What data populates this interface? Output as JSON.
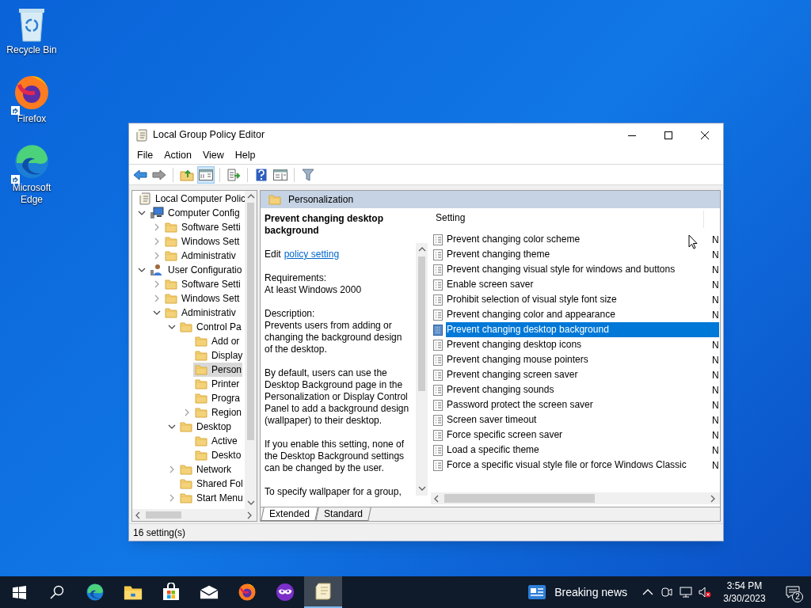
{
  "desktop_icons": [
    {
      "label": "Recycle Bin",
      "kind": "recycle"
    },
    {
      "label": "Firefox",
      "kind": "firefox"
    },
    {
      "label": "Microsoft Edge",
      "kind": "edge"
    }
  ],
  "window": {
    "title": "Local Group Policy Editor"
  },
  "menu": [
    "File",
    "Action",
    "View",
    "Help"
  ],
  "toolbar": [
    {
      "kind": "back",
      "pressed": false
    },
    {
      "kind": "forward",
      "pressed": false
    },
    {
      "kind": "sep"
    },
    {
      "kind": "up",
      "pressed": false
    },
    {
      "kind": "tree",
      "pressed": true
    },
    {
      "kind": "sep"
    },
    {
      "kind": "export",
      "pressed": false
    },
    {
      "kind": "sep"
    },
    {
      "kind": "help",
      "pressed": false
    },
    {
      "kind": "pane",
      "pressed": false
    },
    {
      "kind": "sep"
    },
    {
      "kind": "filter",
      "pressed": false
    }
  ],
  "tree": [
    {
      "label": "Local Computer Polic",
      "kind": "root",
      "selected": false,
      "children": [
        {
          "label": "Computer Config",
          "kind": "computer",
          "expanded": true,
          "selected": false,
          "children": [
            {
              "label": "Software Setti",
              "kind": "folder",
              "expanded": false,
              "selected": false
            },
            {
              "label": "Windows Sett",
              "kind": "folder",
              "expanded": false,
              "selected": false
            },
            {
              "label": "Administrativ",
              "kind": "folder",
              "expanded": false,
              "selected": false
            }
          ]
        },
        {
          "label": "User Configuratio",
          "kind": "user",
          "expanded": true,
          "selected": false,
          "children": [
            {
              "label": "Software Setti",
              "kind": "folder",
              "expanded": false,
              "selected": false
            },
            {
              "label": "Windows Sett",
              "kind": "folder",
              "expanded": false,
              "selected": false
            },
            {
              "label": "Administrativ",
              "kind": "folder",
              "expanded": true,
              "selected": false,
              "children": [
                {
                  "label": "Control Pa",
                  "kind": "folder",
                  "expanded": true,
                  "selected": false,
                  "children": [
                    {
                      "label": "Add or",
                      "kind": "folder",
                      "selected": false
                    },
                    {
                      "label": "Display",
                      "kind": "folder",
                      "selected": false
                    },
                    {
                      "label": "Person",
                      "kind": "folder",
                      "selected": true
                    },
                    {
                      "label": "Printer",
                      "kind": "folder",
                      "selected": false
                    },
                    {
                      "label": "Progra",
                      "kind": "folder",
                      "selected": false
                    },
                    {
                      "label": "Region",
                      "kind": "folder",
                      "expanded": false,
                      "selected": false
                    }
                  ]
                },
                {
                  "label": "Desktop",
                  "kind": "folder",
                  "expanded": true,
                  "selected": false,
                  "children": [
                    {
                      "label": "Active",
                      "kind": "folder",
                      "selected": false
                    },
                    {
                      "label": "Deskto",
                      "kind": "folder",
                      "selected": false
                    }
                  ]
                },
                {
                  "label": "Network",
                  "kind": "folder",
                  "expanded": false,
                  "selected": false
                },
                {
                  "label": "Shared Fol",
                  "kind": "folder",
                  "selected": false
                },
                {
                  "label": "Start Menu",
                  "kind": "folder",
                  "expanded": false,
                  "selected": false
                }
              ]
            }
          ]
        }
      ]
    }
  ],
  "details": {
    "header": "Personalization",
    "policy_title": "Prevent changing desktop background",
    "edit_prefix": "Edit",
    "edit_link": "policy setting",
    "paragraphs": [
      [
        "Requirements:",
        "At least Windows 2000"
      ],
      [
        "Description:",
        "Prevents users from adding or changing the background design of the desktop."
      ],
      [
        "By default, users can use the Desktop Background page in the Personalization or Display Control Panel to add a background design (wallpaper) to their desktop."
      ],
      [
        "If you enable this setting, none of the Desktop Background settings can be changed by the user."
      ],
      [
        "To specify wallpaper for a group,"
      ]
    ]
  },
  "settings": {
    "columns": [
      "Setting"
    ],
    "rows": [
      {
        "name": "Prevent changing color scheme",
        "column_2": "N",
        "selected": false
      },
      {
        "name": "Prevent changing theme",
        "column_2": "N",
        "selected": false
      },
      {
        "name": "Prevent changing visual style for windows and buttons",
        "column_2": "N",
        "selected": false
      },
      {
        "name": "Enable screen saver",
        "column_2": "N",
        "selected": false
      },
      {
        "name": "Prohibit selection of visual style font size",
        "column_2": "N",
        "selected": false
      },
      {
        "name": "Prevent changing color and appearance",
        "column_2": "N",
        "selected": false
      },
      {
        "name": "Prevent changing desktop background",
        "selected": true
      },
      {
        "name": "Prevent changing desktop icons",
        "column_2": "N",
        "selected": false
      },
      {
        "name": "Prevent changing mouse pointers",
        "column_2": "N",
        "selected": false
      },
      {
        "name": "Prevent changing screen saver",
        "column_2": "N",
        "selected": false
      },
      {
        "name": "Prevent changing sounds",
        "column_2": "N",
        "selected": false
      },
      {
        "name": "Password protect the screen saver",
        "column_2": "N",
        "selected": false
      },
      {
        "name": "Screen saver timeout",
        "column_2": "N",
        "selected": false
      },
      {
        "name": "Force specific screen saver",
        "column_2": "N",
        "selected": false
      },
      {
        "name": "Load a specific theme",
        "column_2": "N",
        "selected": false
      },
      {
        "name": "Force a specific visual style file or force Windows Classic",
        "column_2": "N",
        "selected": false
      }
    ]
  },
  "view_tabs": [
    {
      "label": "Extended",
      "selected": true
    },
    {
      "label": "Standard",
      "selected": false
    }
  ],
  "status_bar": "16 setting(s)",
  "taskbar": {
    "apps": [
      {
        "kind": "edge",
        "active": false
      },
      {
        "kind": "explorer",
        "active": false
      },
      {
        "kind": "store",
        "active": false
      },
      {
        "kind": "mail",
        "active": false
      },
      {
        "kind": "firefox",
        "active": false
      },
      {
        "kind": "mask",
        "active": false
      },
      {
        "kind": "scroll",
        "active": true
      }
    ],
    "news": "Breaking news",
    "time": "3:54 PM",
    "date": "3/30/2023",
    "notifications": "2"
  }
}
